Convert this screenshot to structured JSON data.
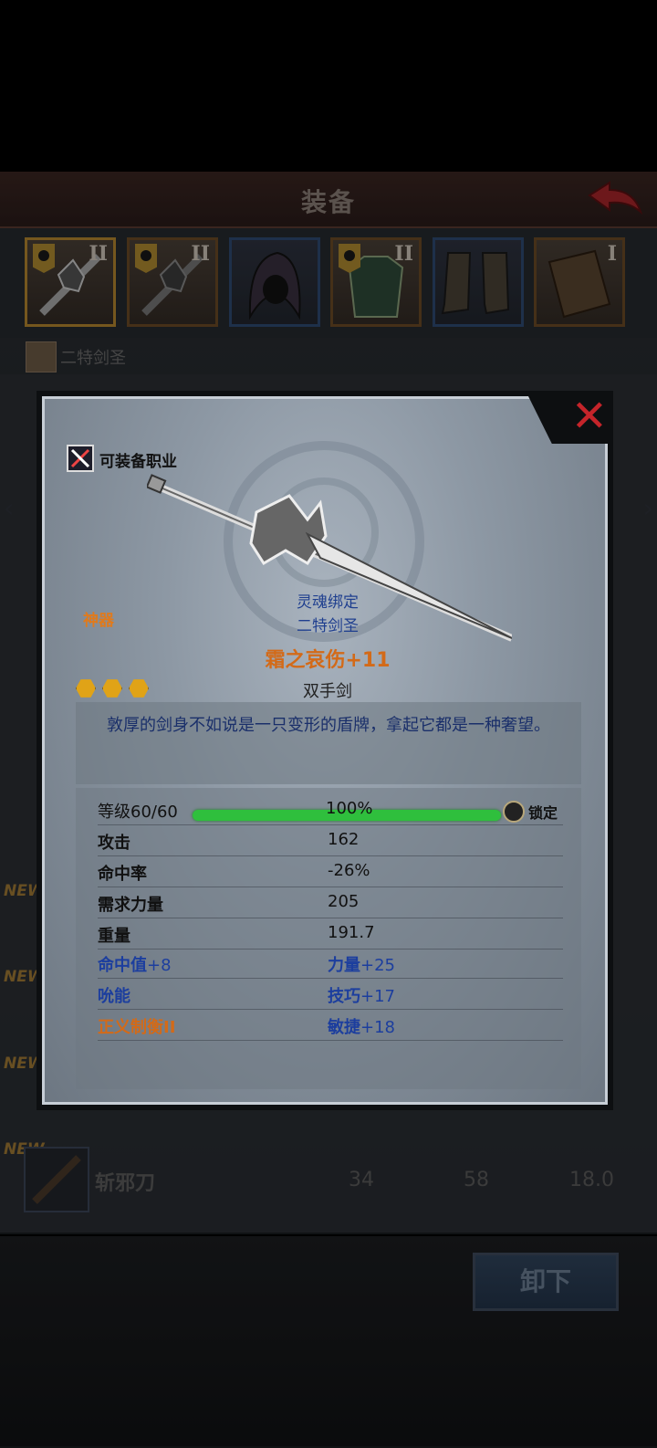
{
  "header": {
    "title": "装备"
  },
  "slots": [
    {
      "icon": "sword-icon",
      "level": "II",
      "frame": "gold"
    },
    {
      "icon": "sword-icon",
      "level": "II",
      "frame": "gold"
    },
    {
      "icon": "hood-icon",
      "level": "",
      "frame": "blue"
    },
    {
      "icon": "armor-icon",
      "level": "II",
      "frame": "gold"
    },
    {
      "icon": "boots-icon",
      "level": "",
      "frame": "blue"
    },
    {
      "icon": "book-icon",
      "level": "I",
      "frame": "gold"
    }
  ],
  "character": {
    "name": "二特剑圣"
  },
  "list": {
    "new_tag": "NEW",
    "row": {
      "name": "斩邪刀",
      "values": [
        "34",
        "58",
        "18.0"
      ]
    }
  },
  "bottom": {
    "unequip_label": "卸下"
  },
  "modal": {
    "class_label": "可装备职业",
    "rarity": "神器",
    "bound_line1": "灵魂绑定",
    "bound_line2": "二特剑圣",
    "item_name": "霜之哀伤+11",
    "item_type": "双手剑",
    "stars": 3,
    "description": "敦厚的剑身不如说是一只变形的盾牌，拿起它都是一种奢望。",
    "level_label": "等级60/60",
    "level_percent": "100%",
    "level_fraction": 1.0,
    "lock_label": "锁定",
    "stats": [
      {
        "label": "攻击",
        "value": "162"
      },
      {
        "label": "命中率",
        "value": "-26%"
      },
      {
        "label": "需求力量",
        "value": "205"
      },
      {
        "label": "重量",
        "value": "191.7"
      }
    ],
    "bonus_rows": [
      {
        "label_main": "命中值",
        "label_extra": "+8",
        "value_main": "力量",
        "value_extra": "+25"
      },
      {
        "label_main": "吮能",
        "label_extra": "",
        "value_main": "技巧",
        "value_extra": "+17"
      },
      {
        "label_main": "正义制衡II",
        "label_extra": "",
        "value_main": "敏捷",
        "value_extra": "+18"
      }
    ]
  },
  "colors": {
    "accent_orange": "#d36a18",
    "bound_blue": "#1f3f8f",
    "close_red": "#c4242a",
    "level_green": "#2fbf3d"
  }
}
